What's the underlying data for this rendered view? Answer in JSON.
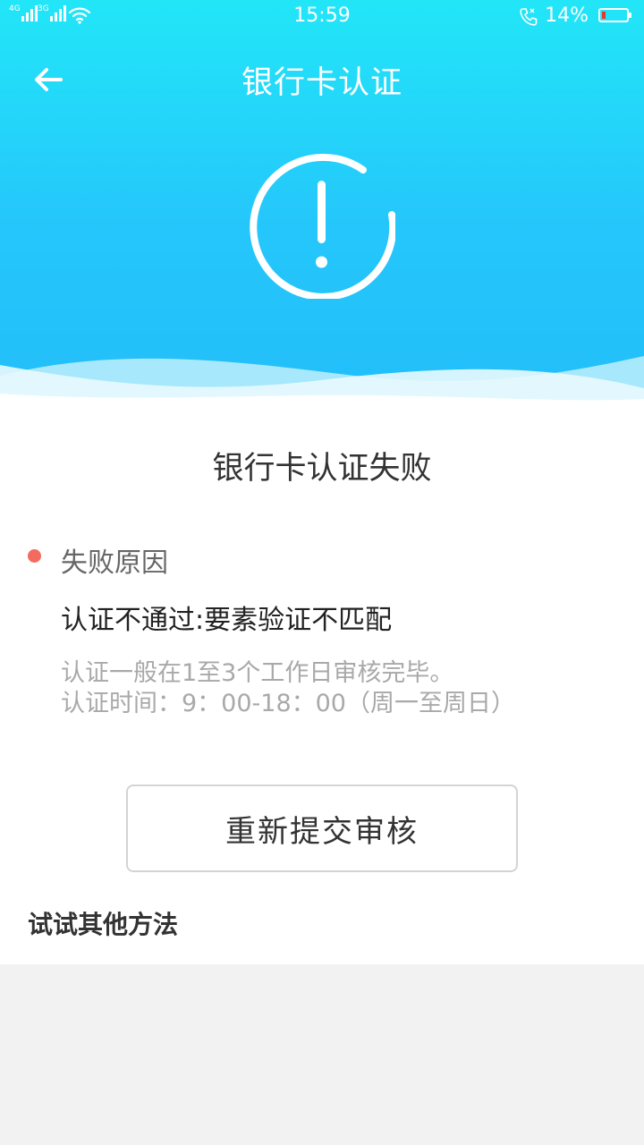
{
  "status_bar": {
    "network_1": "4G",
    "network_2": "3G",
    "time": "15:59",
    "battery_percent_text": "14%",
    "battery_level": 0.14,
    "battery_color": "#e53935"
  },
  "nav": {
    "title": "银行卡认证",
    "back_icon": "arrow-left-icon"
  },
  "hero": {
    "icon": "alert-circle-icon",
    "color_top": "#22e6f8",
    "color_bottom": "#22befa"
  },
  "result": {
    "title": "银行卡认证失败",
    "reason_label": "失败原因",
    "reason_text": "认证不通过:要素验证不匹配",
    "hint_line_1": "认证一般在1至3个工作日审核完毕。",
    "hint_line_2": "认证时间：9：00-18：00（周一至周日）",
    "dot_color": "#f36b5f"
  },
  "actions": {
    "resubmit_label": "重新提交审核"
  },
  "other_methods": {
    "title": "试试其他方法"
  }
}
